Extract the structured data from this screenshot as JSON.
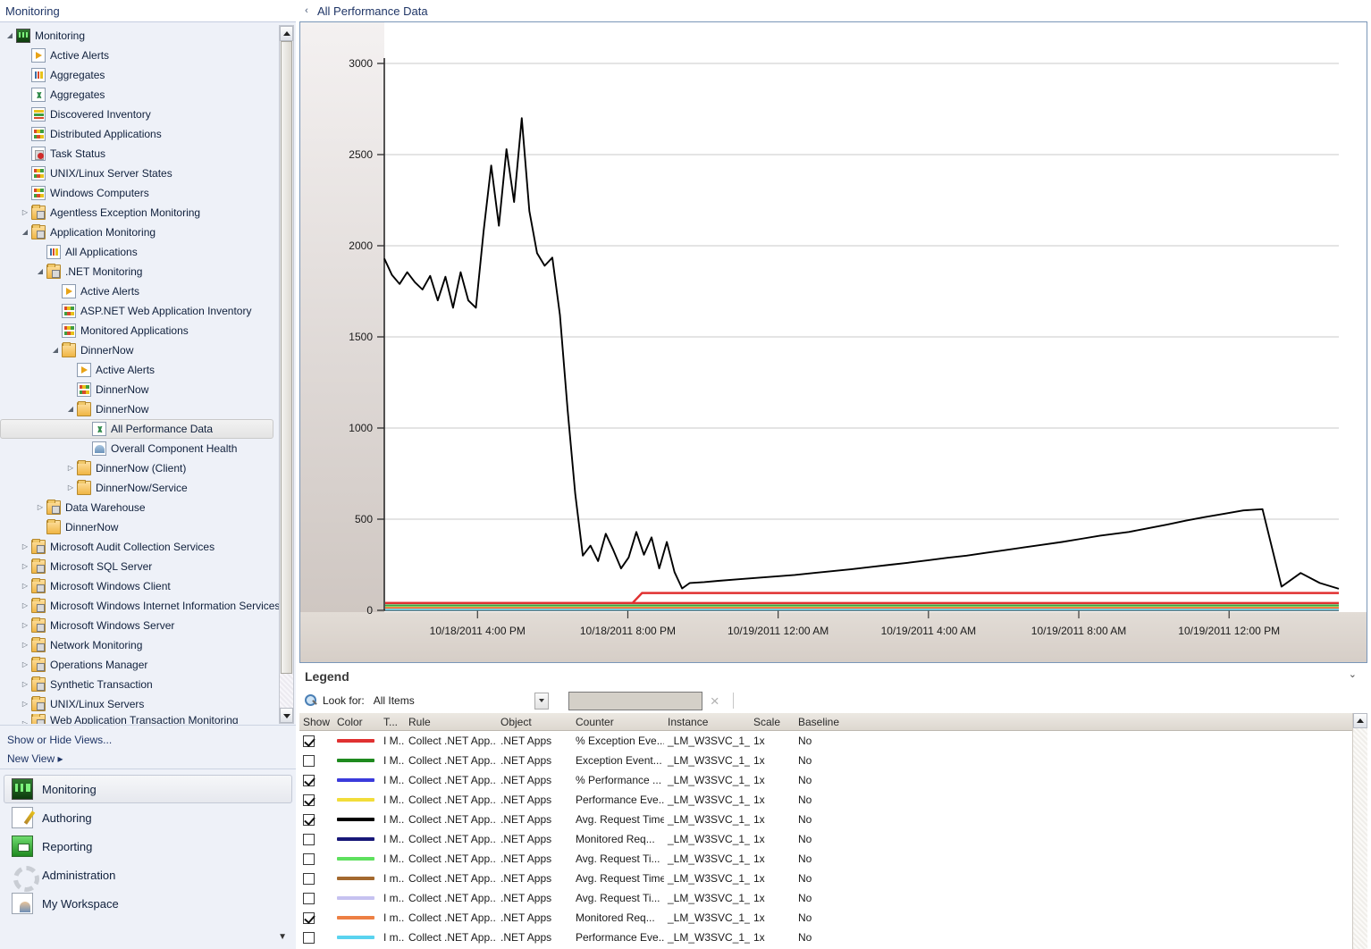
{
  "nav": {
    "header_title": "Monitoring",
    "collapse_icon": "«",
    "tree": [
      {
        "label": "Monitoring",
        "depth": 0,
        "icon": "monitor-icon",
        "expander": "◢"
      },
      {
        "label": "Active Alerts",
        "depth": 1,
        "icon": "alert-icon",
        "expander": ""
      },
      {
        "label": "Aggregates",
        "depth": 1,
        "icon": "bars-icon",
        "expander": ""
      },
      {
        "label": "Aggregates",
        "depth": 1,
        "icon": "chart-icon",
        "expander": ""
      },
      {
        "label": "Discovered Inventory",
        "depth": 1,
        "icon": "inventory-icon",
        "expander": ""
      },
      {
        "label": "Distributed Applications",
        "depth": 1,
        "icon": "grid-icon",
        "expander": ""
      },
      {
        "label": "Task Status",
        "depth": 1,
        "icon": "task-icon",
        "expander": ""
      },
      {
        "label": "UNIX/Linux Server States",
        "depth": 1,
        "icon": "grid-icon",
        "expander": ""
      },
      {
        "label": "Windows Computers",
        "depth": 1,
        "icon": "grid-icon",
        "expander": ""
      },
      {
        "label": "Agentless Exception Monitoring",
        "depth": 1,
        "icon": "folder-lock-icon",
        "expander": "▷"
      },
      {
        "label": "Application Monitoring",
        "depth": 1,
        "icon": "folder-lock-icon",
        "expander": "◢"
      },
      {
        "label": "All Applications",
        "depth": 2,
        "icon": "bars-icon",
        "expander": ""
      },
      {
        "label": ".NET Monitoring",
        "depth": 2,
        "icon": "folder-lock-icon",
        "expander": "◢"
      },
      {
        "label": "Active Alerts",
        "depth": 3,
        "icon": "alert-icon",
        "expander": ""
      },
      {
        "label": "ASP.NET Web Application Inventory",
        "depth": 3,
        "icon": "grid-icon",
        "expander": ""
      },
      {
        "label": "Monitored Applications",
        "depth": 3,
        "icon": "grid-icon",
        "expander": ""
      },
      {
        "label": "DinnerNow",
        "depth": 3,
        "icon": "folder-icon",
        "expander": "◢"
      },
      {
        "label": "Active Alerts",
        "depth": 4,
        "icon": "alert-icon",
        "expander": ""
      },
      {
        "label": "DinnerNow",
        "depth": 4,
        "icon": "grid-icon",
        "expander": ""
      },
      {
        "label": "DinnerNow",
        "depth": 4,
        "icon": "folder-icon",
        "expander": "◢"
      },
      {
        "label": "All Performance Data",
        "depth": 5,
        "icon": "chart-icon",
        "expander": "",
        "selected": true
      },
      {
        "label": "Overall Component Health",
        "depth": 5,
        "icon": "gauge-icon",
        "expander": ""
      },
      {
        "label": "DinnerNow (Client)",
        "depth": 4,
        "icon": "folder-icon",
        "expander": "▷"
      },
      {
        "label": "DinnerNow/Service",
        "depth": 4,
        "icon": "folder-icon",
        "expander": "▷"
      },
      {
        "label": "Data Warehouse",
        "depth": 2,
        "icon": "folder-lock-icon",
        "expander": "▷"
      },
      {
        "label": "DinnerNow",
        "depth": 2,
        "icon": "folder-icon",
        "expander": ""
      },
      {
        "label": "Microsoft Audit Collection Services",
        "depth": 1,
        "icon": "folder-lock-icon",
        "expander": "▷"
      },
      {
        "label": "Microsoft SQL Server",
        "depth": 1,
        "icon": "folder-lock-icon",
        "expander": "▷"
      },
      {
        "label": "Microsoft Windows Client",
        "depth": 1,
        "icon": "folder-lock-icon",
        "expander": "▷"
      },
      {
        "label": "Microsoft Windows Internet Information Services",
        "depth": 1,
        "icon": "folder-lock-icon",
        "expander": "▷"
      },
      {
        "label": "Microsoft Windows Server",
        "depth": 1,
        "icon": "folder-lock-icon",
        "expander": "▷"
      },
      {
        "label": "Network Monitoring",
        "depth": 1,
        "icon": "folder-lock-icon",
        "expander": "▷"
      },
      {
        "label": "Operations Manager",
        "depth": 1,
        "icon": "folder-lock-icon",
        "expander": "▷"
      },
      {
        "label": "Synthetic Transaction",
        "depth": 1,
        "icon": "folder-lock-icon",
        "expander": "▷"
      },
      {
        "label": "UNIX/Linux Servers",
        "depth": 1,
        "icon": "folder-lock-icon",
        "expander": "▷"
      },
      {
        "label": "Web Application Transaction Monitoring",
        "depth": 1,
        "icon": "folder-lock-icon",
        "expander": "▷",
        "clipped": true
      }
    ],
    "links": [
      {
        "label": "Show or Hide Views..."
      },
      {
        "label": "New View ▸"
      }
    ],
    "buttons": [
      {
        "label": "Monitoring",
        "icon": "monitoring-icon",
        "active": true
      },
      {
        "label": "Authoring",
        "icon": "authoring-icon",
        "active": false
      },
      {
        "label": "Reporting",
        "icon": "reporting-icon",
        "active": false
      },
      {
        "label": "Administration",
        "icon": "administration-icon",
        "active": false
      },
      {
        "label": "My Workspace",
        "icon": "workspace-icon",
        "active": false
      }
    ],
    "more_icon": "▼"
  },
  "content": {
    "collapse_icon": "‹",
    "title": "All Performance Data"
  },
  "chart_data": {
    "type": "line",
    "title": "All Performance Data",
    "xlabel": "",
    "ylabel": "",
    "ylim": [
      0,
      3000
    ],
    "yticks": [
      0,
      500,
      1000,
      1500,
      2000,
      2500,
      3000
    ],
    "grid": true,
    "legend_position": "bottom-table",
    "xticks": [
      "10/18/2011 4:00 PM",
      "10/18/2011 8:00 PM",
      "10/19/2011 12:00 AM",
      "10/19/2011 4:00 AM",
      "10/19/2011 8:00 AM",
      "10/19/2011 12:00 PM"
    ],
    "series": [
      {
        "name": "Avg. Request Time",
        "color": "#000000",
        "visible": true,
        "x": [
          0,
          0.8,
          1.6,
          2.4,
          3.2,
          4.0,
          4.8,
          5.6,
          6.4,
          7.2,
          8.0,
          8.8,
          9.6,
          10.4,
          11.2,
          12.0,
          12.8,
          13.6,
          14.4,
          15.2,
          16.0,
          16.8,
          17.6,
          18.4,
          19.2,
          20.0,
          20.8,
          21.6,
          22.4,
          23.2,
          24.0,
          24.8,
          25.6,
          26.4,
          27.2,
          28.0,
          28.8,
          29.6,
          30.4,
          31.2,
          32.0,
          33.5,
          35,
          37,
          39,
          41,
          43,
          45,
          47,
          49,
          51,
          53,
          55,
          57,
          59,
          61,
          63,
          65,
          67,
          69,
          71,
          73,
          75,
          78,
          80,
          82,
          84,
          86,
          88,
          90,
          92,
          94,
          96,
          98,
          100
        ],
        "y": [
          1930,
          1840,
          1790,
          1855,
          1800,
          1760,
          1835,
          1700,
          1830,
          1660,
          1855,
          1700,
          1660,
          2080,
          2440,
          2110,
          2530,
          2240,
          2700,
          2190,
          1960,
          1890,
          1935,
          1620,
          1100,
          640,
          300,
          355,
          270,
          420,
          330,
          230,
          290,
          430,
          305,
          400,
          230,
          375,
          210,
          120,
          150,
          155,
          162,
          170,
          178,
          186,
          194,
          205,
          215,
          226,
          238,
          250,
          262,
          275,
          288,
          300,
          315,
          330,
          345,
          360,
          375,
          392,
          410,
          430,
          450,
          470,
          492,
          512,
          530,
          548,
          555,
          130,
          205,
          150,
          118
        ],
        "note": "Black primary series: high plateau ~1900 early, spike to 2700, crash to ~300, long linear ramp to ~550, then drop to ~120 with noise"
      },
      {
        "name": "% Exception Events",
        "color": "#e03131",
        "visible": true,
        "baseline_value": 40
      },
      {
        "name": "Exception Events",
        "color": "#1f8a1f",
        "visible": false,
        "baseline_value": 28
      },
      {
        "name": "% Performance Events",
        "color": "#3b3bdb",
        "visible": true,
        "baseline_value": 12
      },
      {
        "name": "Performance Events",
        "color": "#f2dd3a",
        "visible": true,
        "baseline_value": 10
      },
      {
        "name": "Monitored Requests",
        "color": "#181878",
        "visible": false,
        "baseline_value": 8
      },
      {
        "name": "Avg. Request Time",
        "color": "#5ee05e",
        "visible": false,
        "baseline_value": 20
      },
      {
        "name": "Avg. Request Time",
        "color": "#a3692f",
        "visible": false,
        "baseline_value": 6
      },
      {
        "name": "Avg. Request Time",
        "color": "#c6c2f0",
        "visible": false,
        "baseline_value": 5
      },
      {
        "name": "Monitored Requests",
        "color": "#ed8martin",
        "visible": true,
        "baseline_value": 14
      },
      {
        "name": "Performance Events",
        "color": "#5ad3ef",
        "visible": false,
        "baseline_value": 4
      }
    ]
  },
  "legend": {
    "title": "Legend",
    "collapse_icon": "⌄",
    "lookfor_label": "Look for:",
    "lookfor_value": "All Items",
    "search_value": "",
    "clear_icon": "×",
    "columns": [
      "Show",
      "Color",
      "T...",
      "Rule",
      "Object",
      "Counter",
      "Instance",
      "Scale",
      "Baseline"
    ],
    "rows": [
      {
        "show": true,
        "color": "#e03131",
        "type": "I M...",
        "rule": "Collect .NET App...",
        "object": ".NET Apps",
        "counter": "% Exception Eve...",
        "instance": "_LM_W3SVC_1_...",
        "scale": "1x",
        "baseline": "No"
      },
      {
        "show": false,
        "color": "#1f8a1f",
        "type": "I M...",
        "rule": "Collect .NET App...",
        "object": ".NET Apps",
        "counter": "Exception Event...",
        "instance": "_LM_W3SVC_1_...",
        "scale": "1x",
        "baseline": "No"
      },
      {
        "show": true,
        "color": "#3b3bdb",
        "type": "I M...",
        "rule": "Collect .NET App...",
        "object": ".NET Apps",
        "counter": "% Performance ...",
        "instance": "_LM_W3SVC_1_...",
        "scale": "1x",
        "baseline": "No"
      },
      {
        "show": true,
        "color": "#f2dd3a",
        "type": "I M...",
        "rule": "Collect .NET App...",
        "object": ".NET Apps",
        "counter": "Performance Eve...",
        "instance": "_LM_W3SVC_1_...",
        "scale": "1x",
        "baseline": "No"
      },
      {
        "show": true,
        "color": "#000000",
        "type": "I M...",
        "rule": "Collect .NET App...",
        "object": ".NET Apps",
        "counter": "Avg. Request Time",
        "instance": "_LM_W3SVC_1_...",
        "scale": "1x",
        "baseline": "No"
      },
      {
        "show": false,
        "color": "#181878",
        "type": "I M...",
        "rule": "Collect .NET App...",
        "object": ".NET Apps",
        "counter": "Monitored Req...",
        "instance": "_LM_W3SVC_1_...",
        "scale": "1x",
        "baseline": "No"
      },
      {
        "show": false,
        "color": "#5ee05e",
        "type": "I M...",
        "rule": "Collect .NET App...",
        "object": ".NET Apps",
        "counter": "Avg. Request Ti...",
        "instance": "_LM_W3SVC_1_...",
        "scale": "1x",
        "baseline": "No"
      },
      {
        "show": false,
        "color": "#a3692f",
        "type": "I m...",
        "rule": "Collect .NET App...",
        "object": ".NET Apps",
        "counter": "Avg. Request Time",
        "instance": "_LM_W3SVC_1_...",
        "scale": "1x",
        "baseline": "No"
      },
      {
        "show": false,
        "color": "#c6c2f0",
        "type": "I m...",
        "rule": "Collect .NET App...",
        "object": ".NET Apps",
        "counter": "Avg. Request Ti...",
        "instance": "_LM_W3SVC_1_...",
        "scale": "1x",
        "baseline": "No"
      },
      {
        "show": true,
        "color": "#ed8044",
        "type": "I m...",
        "rule": "Collect .NET App...",
        "object": ".NET Apps",
        "counter": "Monitored Req...",
        "instance": "_LM_W3SVC_1_...",
        "scale": "1x",
        "baseline": "No"
      },
      {
        "show": false,
        "color": "#5ad3ef",
        "type": "I m...",
        "rule": "Collect .NET App...",
        "object": ".NET Apps",
        "counter": "Performance Eve...",
        "instance": "_LM_W3SVC_1_...",
        "scale": "1x",
        "baseline": "No"
      }
    ]
  }
}
